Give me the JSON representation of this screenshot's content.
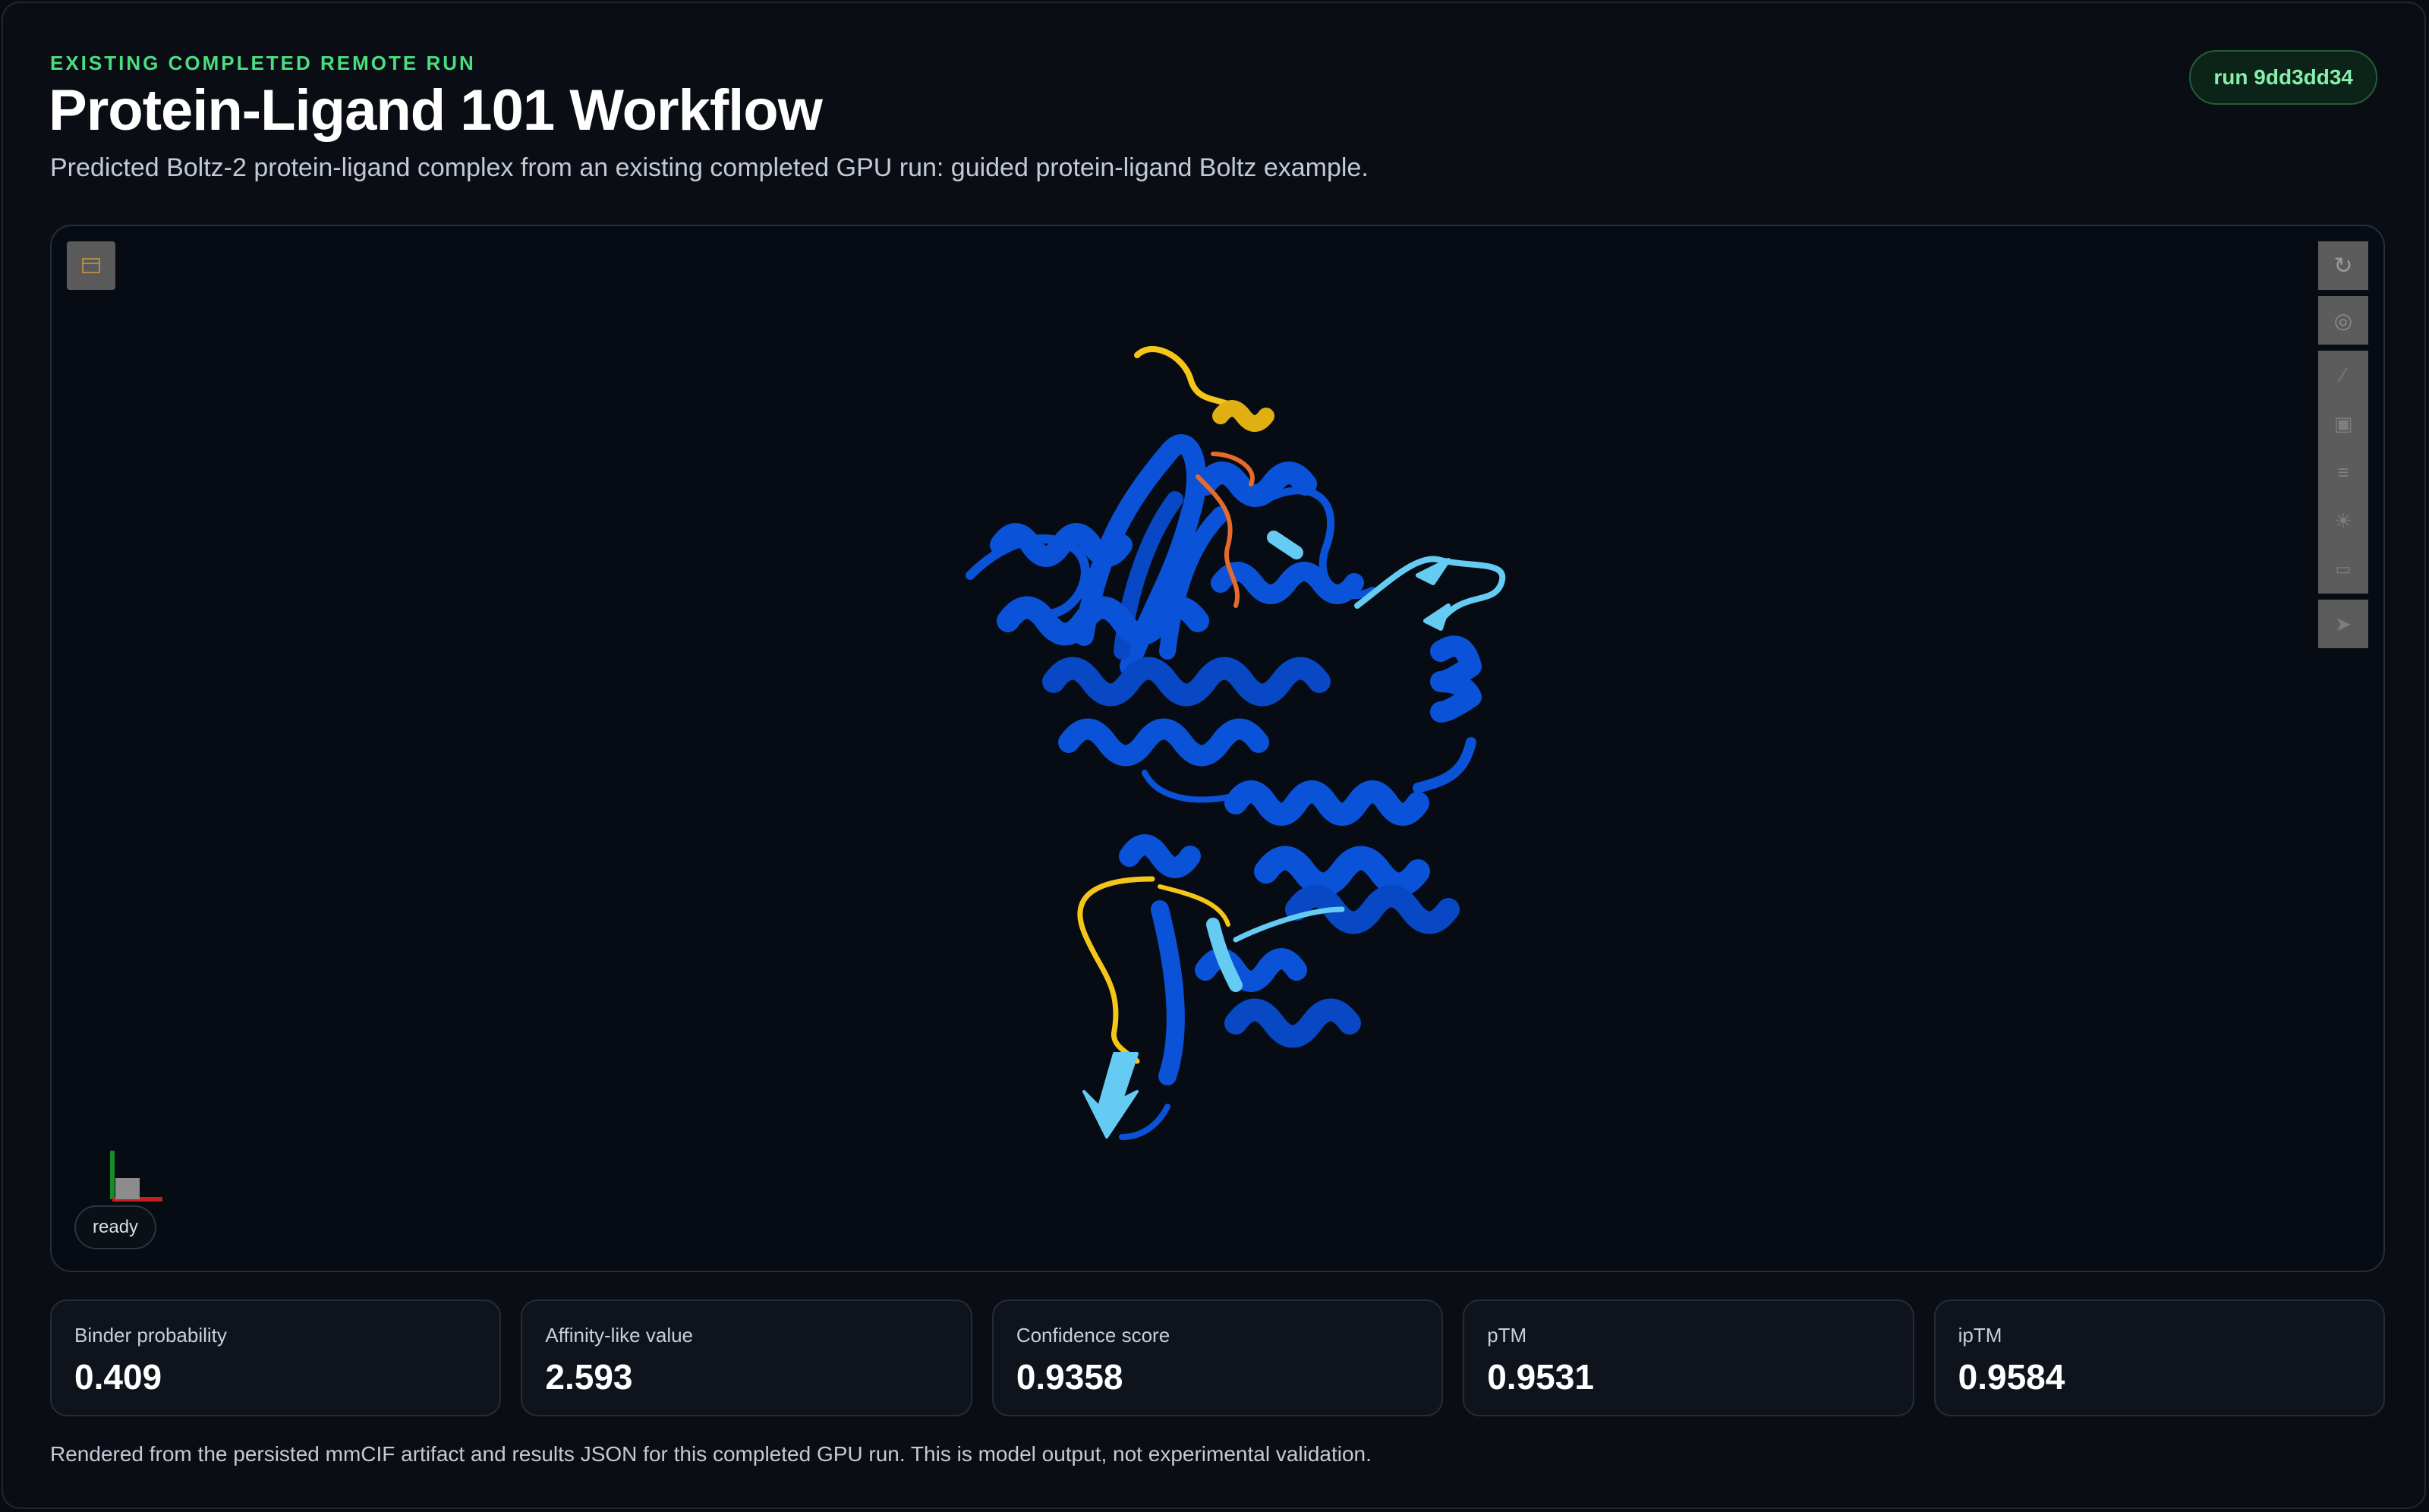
{
  "header": {
    "eyebrow": "EXISTING COMPLETED REMOTE RUN",
    "title": "Protein-Ligand 101 Workflow",
    "subtitle": "Predicted Boltz-2 protein-ligand complex from an existing completed GPU run: guided protein-ligand Boltz example.",
    "run_badge": "run 9dd3dd34"
  },
  "viewer": {
    "status": "ready",
    "toolbar": [
      {
        "icon": "reset-icon"
      },
      {
        "icon": "spin-icon"
      },
      {
        "icon": "measure-icon"
      },
      {
        "icon": "screenshot-icon"
      },
      {
        "icon": "settings-icon"
      },
      {
        "icon": "lighting-icon"
      },
      {
        "icon": "selection-icon"
      },
      {
        "icon": "pointer-icon"
      }
    ],
    "colors": {
      "very_high": "#0a53d9",
      "high": "#65cbf3",
      "low": "#f5c518",
      "very_low": "#e66a2c"
    }
  },
  "metrics": [
    {
      "label": "Binder probability",
      "value": "0.409"
    },
    {
      "label": "Affinity-like value",
      "value": "2.593"
    },
    {
      "label": "Confidence score",
      "value": "0.9358"
    },
    {
      "label": "pTM",
      "value": "0.9531"
    },
    {
      "label": "ipTM",
      "value": "0.9584"
    }
  ],
  "footnote": "Rendered from the persisted mmCIF artifact and results JSON for this completed GPU run. This is model output, not experimental validation.",
  "theme": {
    "accent_green": "#4ade80",
    "background": "#080b10"
  }
}
